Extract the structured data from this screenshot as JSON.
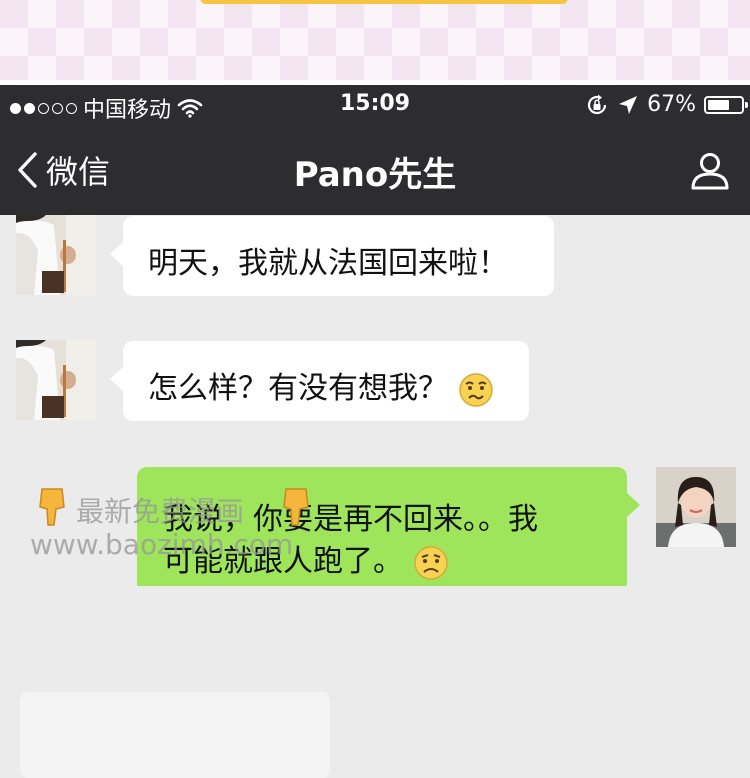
{
  "status_bar": {
    "carrier": "中国移动",
    "time": "15:09",
    "battery": "67%",
    "battery_level": 0.67
  },
  "nav": {
    "back_label": "微信",
    "title": "Pano先生"
  },
  "messages": [
    {
      "from": "contact",
      "text": "明天，我就从法国回来啦！"
    },
    {
      "from": "contact",
      "text": "怎么样？有没有想我？",
      "emoji": "confused-face"
    },
    {
      "from": "me",
      "lines": [
        "我说，你要是再不回来。。我",
        "可能就跟人跑了。"
      ],
      "emoji": "sad-face"
    }
  ],
  "watermark": {
    "line1": "最新免费漫画",
    "line2": "www.baozimh.com"
  },
  "colors": {
    "bar": "#2d2d2f",
    "chat_bg": "#ebebeb",
    "bubble_out": "#9ee55b",
    "bubble_in": "#ffffff"
  }
}
